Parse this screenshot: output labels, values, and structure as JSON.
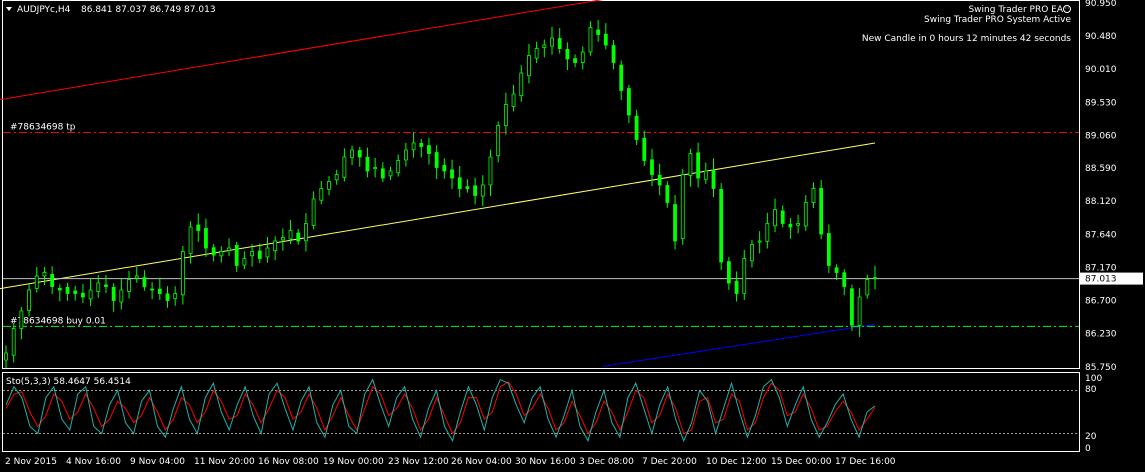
{
  "header": {
    "symbol": "AUDJPYc,H4",
    "ohlc": "86.841 87.037 86.749 87.013"
  },
  "ea": {
    "name": "Swing Trader PRO EA",
    "status": "Swing Trader PRO System Active",
    "countdown": "New Candle in 0 hours 12 minutes 42 seconds"
  },
  "price_axis": {
    "labels": [
      "90.950",
      "90.480",
      "90.010",
      "89.530",
      "89.060",
      "88.590",
      "88.120",
      "87.640",
      "87.170",
      "86.700",
      "86.230",
      "85.750"
    ],
    "current_price": "87.013"
  },
  "order_lines": {
    "tp_label": "#78634698 tp",
    "buy_label": "#78634698 buy 0.01",
    "tp_color": "#ff0000",
    "buy_color": "#00ff00"
  },
  "indicator": {
    "label": "Sto(5,3,3) 58.4647 56.4514",
    "levels": [
      "100",
      "80",
      "20",
      "0"
    ],
    "main_color": "#20b2aa",
    "signal_color": "#ff0000"
  },
  "time_axis": {
    "labels": [
      "2 Nov 2015",
      "4 Nov 16:00",
      "9 Nov 04:00",
      "11 Nov 20:00",
      "16 Nov 08:00",
      "19 Nov 00:00",
      "23 Nov 12:00",
      "26 Nov 04:00",
      "30 Nov 16:00",
      "3 Dec 08:00",
      "7 Dec 20:00",
      "10 Dec 12:00",
      "15 Dec 00:00",
      "17 Dec 16:00"
    ]
  },
  "colors": {
    "background": "#000000",
    "candle": "#00ff00",
    "grid": "#ffffff",
    "channel_upper": "#ff0000",
    "channel_middle": "#ffff66",
    "channel_lower": "#0000ff"
  },
  "chart_data": {
    "type": "candlestick",
    "series": [
      {
        "name": "AUDJPYc,H4",
        "close": [
          85.95,
          86.3,
          86.55,
          86.85,
          87.05,
          87.1,
          86.9,
          86.85,
          86.8,
          86.8,
          86.75,
          86.85,
          86.95,
          86.9,
          86.7,
          86.85,
          87.0,
          87.05,
          86.9,
          86.85,
          86.8,
          86.7,
          86.8,
          87.4,
          87.75,
          87.7,
          87.45,
          87.35,
          87.4,
          87.45,
          87.2,
          87.3,
          87.4,
          87.3,
          87.45,
          87.55,
          87.6,
          87.7,
          87.55,
          87.8,
          88.15,
          88.3,
          88.4,
          88.5,
          88.75,
          88.85,
          88.75,
          88.55,
          88.6,
          88.45,
          88.55,
          88.7,
          88.85,
          88.95,
          88.9,
          88.8,
          88.6,
          88.55,
          88.45,
          88.3,
          88.3,
          88.2,
          88.35,
          88.75,
          89.2,
          89.5,
          89.65,
          89.95,
          90.2,
          90.3,
          90.35,
          90.45,
          90.3,
          90.15,
          90.1,
          90.25,
          90.6,
          90.5,
          90.35,
          90.1,
          89.7,
          89.35,
          89.0,
          88.7,
          88.5,
          88.35,
          88.1,
          87.55,
          88.5,
          88.8,
          88.45,
          88.55,
          88.3,
          87.25,
          86.95,
          86.8,
          87.3,
          87.5,
          87.55,
          87.8,
          88.0,
          87.8,
          87.75,
          87.8,
          88.1,
          88.3,
          87.65,
          87.2,
          87.1,
          86.9,
          86.35,
          86.75,
          87.0,
          87.01
        ]
      }
    ],
    "price_ylim": [
      85.75,
      90.95
    ],
    "current_price": 87.013,
    "tp_level": 89.1,
    "buy_level": 86.33,
    "channel": {
      "upper": [
        [
          0,
          89.57
        ],
        [
          603,
          91.0
        ]
      ],
      "middle": [
        [
          0,
          86.87
        ],
        [
          875,
          88.95
        ]
      ],
      "lower": [
        [
          603,
          85.76
        ],
        [
          875,
          86.36
        ]
      ]
    },
    "stochastic": {
      "main": [
        60,
        85,
        70,
        30,
        20,
        70,
        85,
        40,
        25,
        75,
        85,
        30,
        20,
        60,
        80,
        35,
        20,
        65,
        80,
        30,
        15,
        55,
        85,
        40,
        20,
        70,
        90,
        50,
        25,
        60,
        85,
        45,
        20,
        75,
        90,
        55,
        25,
        65,
        85,
        35,
        15,
        60,
        80,
        30,
        20,
        75,
        95,
        60,
        30,
        70,
        85,
        40,
        15,
        55,
        80,
        30,
        10,
        50,
        85,
        60,
        25,
        70,
        95,
        90,
        60,
        35,
        70,
        85,
        40,
        15,
        45,
        80,
        30,
        10,
        50,
        80,
        35,
        15,
        70,
        90,
        55,
        20,
        60,
        85,
        40,
        10,
        35,
        80,
        65,
        20,
        55,
        90,
        50,
        15,
        45,
        85,
        95,
        70,
        30,
        60,
        85,
        40,
        15,
        35,
        60,
        75,
        40,
        15,
        50,
        58.46
      ],
      "signal": [
        55,
        75,
        78,
        50,
        30,
        45,
        75,
        65,
        40,
        50,
        75,
        55,
        30,
        40,
        65,
        55,
        35,
        45,
        70,
        50,
        25,
        40,
        70,
        60,
        35,
        50,
        80,
        65,
        40,
        45,
        75,
        60,
        35,
        55,
        80,
        70,
        40,
        50,
        75,
        55,
        25,
        45,
        70,
        45,
        25,
        55,
        85,
        75,
        45,
        55,
        75,
        55,
        25,
        40,
        70,
        45,
        20,
        35,
        70,
        70,
        40,
        50,
        85,
        92,
        75,
        45,
        55,
        75,
        55,
        25,
        35,
        65,
        45,
        20,
        35,
        65,
        50,
        25,
        50,
        80,
        70,
        35,
        45,
        75,
        55,
        20,
        25,
        65,
        70,
        35,
        40,
        75,
        65,
        25,
        35,
        70,
        90,
        80,
        45,
        50,
        75,
        55,
        25,
        30,
        50,
        65,
        50,
        25,
        40,
        56.45
      ]
    },
    "stoch_levels": [
      80,
      20
    ]
  }
}
